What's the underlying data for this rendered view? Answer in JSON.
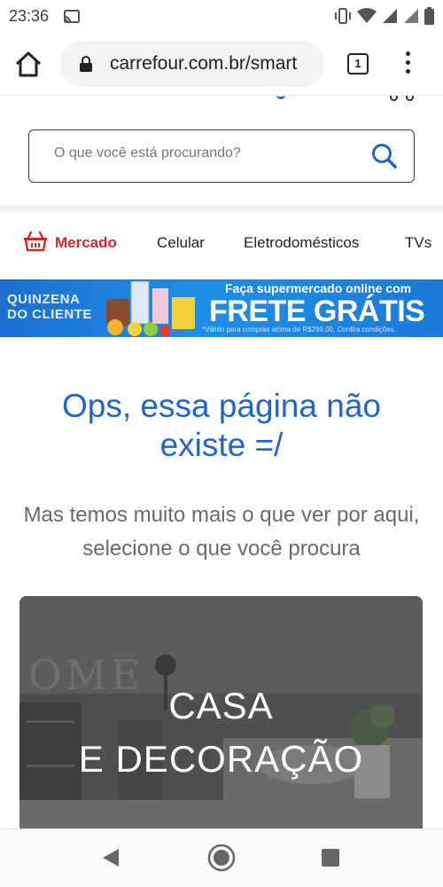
{
  "status_bar": {
    "time": "23:36"
  },
  "browser": {
    "url": "carrefour.com.br/smart",
    "tab_count": "1"
  },
  "search": {
    "placeholder": "O que você está procurando?"
  },
  "categories": [
    {
      "label": "Mercado"
    },
    {
      "label": "Celular"
    },
    {
      "label": "Eletrodomésticos"
    },
    {
      "label": "TVs"
    }
  ],
  "promo": {
    "left_line1": "QUINZENA",
    "left_line2": "DO CLIENTE",
    "line1": "Faça supermercado online com",
    "line2": "FRETE GRÁTIS",
    "line3": "*Válido para compras acima de R$299,00. Confira condições."
  },
  "error": {
    "title": "Ops, essa página não existe =/",
    "subtitle": "Mas temos muito mais o que ver por aqui, selecione o que você procura"
  },
  "card": {
    "line1": "CASA",
    "line2": "E DECORAÇÃO"
  },
  "colors": {
    "brand_blue": "#1f66c8",
    "brand_red": "#d7262b",
    "banner_blue": "#1a7ad8"
  }
}
